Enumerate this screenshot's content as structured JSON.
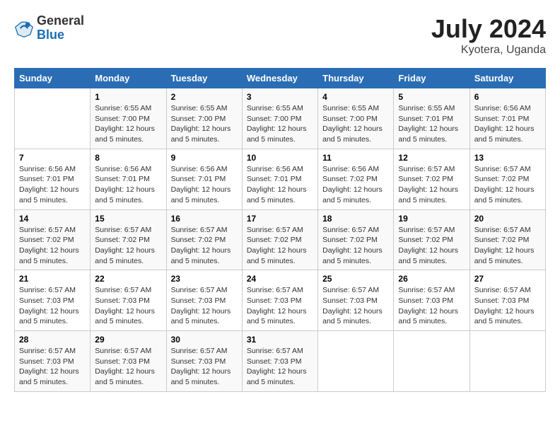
{
  "logo": {
    "line1": "General",
    "line2": "Blue"
  },
  "title": "July 2024",
  "subtitle": "Kyotera, Uganda",
  "days_header": [
    "Sunday",
    "Monday",
    "Tuesday",
    "Wednesday",
    "Thursday",
    "Friday",
    "Saturday"
  ],
  "weeks": [
    [
      {
        "day": "",
        "info": ""
      },
      {
        "day": "1",
        "info": "Sunrise: 6:55 AM\nSunset: 7:00 PM\nDaylight: 12 hours\nand 5 minutes."
      },
      {
        "day": "2",
        "info": "Sunrise: 6:55 AM\nSunset: 7:00 PM\nDaylight: 12 hours\nand 5 minutes."
      },
      {
        "day": "3",
        "info": "Sunrise: 6:55 AM\nSunset: 7:00 PM\nDaylight: 12 hours\nand 5 minutes."
      },
      {
        "day": "4",
        "info": "Sunrise: 6:55 AM\nSunset: 7:00 PM\nDaylight: 12 hours\nand 5 minutes."
      },
      {
        "day": "5",
        "info": "Sunrise: 6:55 AM\nSunset: 7:01 PM\nDaylight: 12 hours\nand 5 minutes."
      },
      {
        "day": "6",
        "info": "Sunrise: 6:56 AM\nSunset: 7:01 PM\nDaylight: 12 hours\nand 5 minutes."
      }
    ],
    [
      {
        "day": "7",
        "info": "Sunrise: 6:56 AM\nSunset: 7:01 PM\nDaylight: 12 hours\nand 5 minutes."
      },
      {
        "day": "8",
        "info": "Sunrise: 6:56 AM\nSunset: 7:01 PM\nDaylight: 12 hours\nand 5 minutes."
      },
      {
        "day": "9",
        "info": "Sunrise: 6:56 AM\nSunset: 7:01 PM\nDaylight: 12 hours\nand 5 minutes."
      },
      {
        "day": "10",
        "info": "Sunrise: 6:56 AM\nSunset: 7:01 PM\nDaylight: 12 hours\nand 5 minutes."
      },
      {
        "day": "11",
        "info": "Sunrise: 6:56 AM\nSunset: 7:02 PM\nDaylight: 12 hours\nand 5 minutes."
      },
      {
        "day": "12",
        "info": "Sunrise: 6:57 AM\nSunset: 7:02 PM\nDaylight: 12 hours\nand 5 minutes."
      },
      {
        "day": "13",
        "info": "Sunrise: 6:57 AM\nSunset: 7:02 PM\nDaylight: 12 hours\nand 5 minutes."
      }
    ],
    [
      {
        "day": "14",
        "info": "Sunrise: 6:57 AM\nSunset: 7:02 PM\nDaylight: 12 hours\nand 5 minutes."
      },
      {
        "day": "15",
        "info": "Sunrise: 6:57 AM\nSunset: 7:02 PM\nDaylight: 12 hours\nand 5 minutes."
      },
      {
        "day": "16",
        "info": "Sunrise: 6:57 AM\nSunset: 7:02 PM\nDaylight: 12 hours\nand 5 minutes."
      },
      {
        "day": "17",
        "info": "Sunrise: 6:57 AM\nSunset: 7:02 PM\nDaylight: 12 hours\nand 5 minutes."
      },
      {
        "day": "18",
        "info": "Sunrise: 6:57 AM\nSunset: 7:02 PM\nDaylight: 12 hours\nand 5 minutes."
      },
      {
        "day": "19",
        "info": "Sunrise: 6:57 AM\nSunset: 7:02 PM\nDaylight: 12 hours\nand 5 minutes."
      },
      {
        "day": "20",
        "info": "Sunrise: 6:57 AM\nSunset: 7:02 PM\nDaylight: 12 hours\nand 5 minutes."
      }
    ],
    [
      {
        "day": "21",
        "info": "Sunrise: 6:57 AM\nSunset: 7:03 PM\nDaylight: 12 hours\nand 5 minutes."
      },
      {
        "day": "22",
        "info": "Sunrise: 6:57 AM\nSunset: 7:03 PM\nDaylight: 12 hours\nand 5 minutes."
      },
      {
        "day": "23",
        "info": "Sunrise: 6:57 AM\nSunset: 7:03 PM\nDaylight: 12 hours\nand 5 minutes."
      },
      {
        "day": "24",
        "info": "Sunrise: 6:57 AM\nSunset: 7:03 PM\nDaylight: 12 hours\nand 5 minutes."
      },
      {
        "day": "25",
        "info": "Sunrise: 6:57 AM\nSunset: 7:03 PM\nDaylight: 12 hours\nand 5 minutes."
      },
      {
        "day": "26",
        "info": "Sunrise: 6:57 AM\nSunset: 7:03 PM\nDaylight: 12 hours\nand 5 minutes."
      },
      {
        "day": "27",
        "info": "Sunrise: 6:57 AM\nSunset: 7:03 PM\nDaylight: 12 hours\nand 5 minutes."
      }
    ],
    [
      {
        "day": "28",
        "info": "Sunrise: 6:57 AM\nSunset: 7:03 PM\nDaylight: 12 hours\nand 5 minutes."
      },
      {
        "day": "29",
        "info": "Sunrise: 6:57 AM\nSunset: 7:03 PM\nDaylight: 12 hours\nand 5 minutes."
      },
      {
        "day": "30",
        "info": "Sunrise: 6:57 AM\nSunset: 7:03 PM\nDaylight: 12 hours\nand 5 minutes."
      },
      {
        "day": "31",
        "info": "Sunrise: 6:57 AM\nSunset: 7:03 PM\nDaylight: 12 hours\nand 5 minutes."
      },
      {
        "day": "",
        "info": ""
      },
      {
        "day": "",
        "info": ""
      },
      {
        "day": "",
        "info": ""
      }
    ]
  ]
}
